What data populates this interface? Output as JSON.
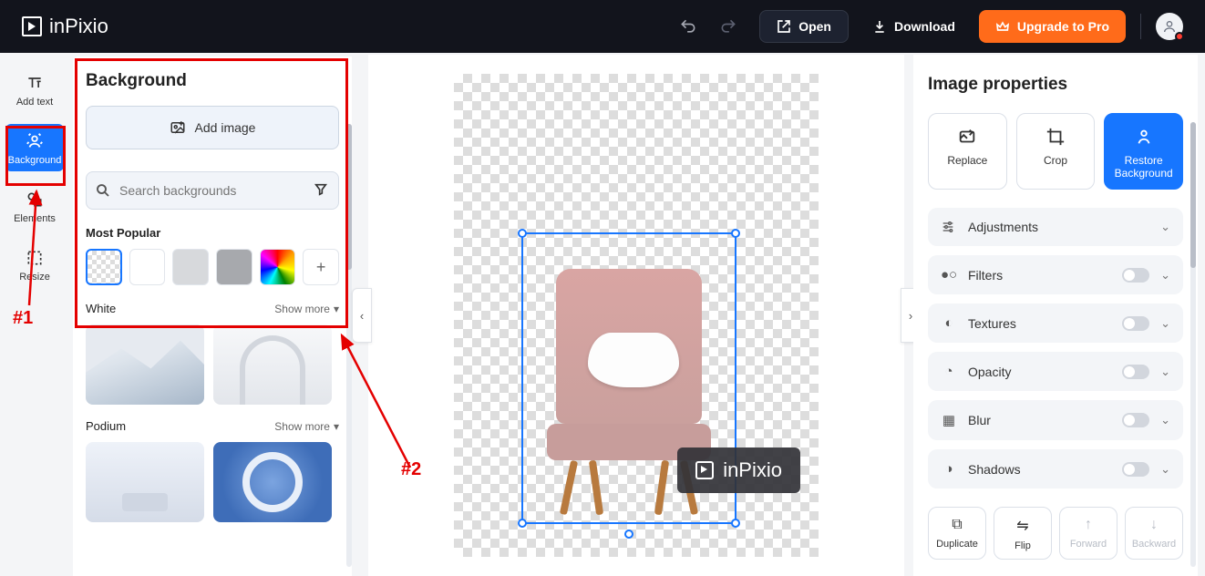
{
  "app_name": "inPixio",
  "header": {
    "undo_label": "Undo",
    "redo_label": "Redo",
    "open_label": "Open",
    "download_label": "Download",
    "upgrade_label": "Upgrade to Pro"
  },
  "rail": {
    "add_text": "Add text",
    "background": "Background",
    "elements": "Elements",
    "resize": "Resize"
  },
  "side": {
    "title": "Background",
    "add_image": "Add image",
    "search_placeholder": "Search backgrounds",
    "most_popular": "Most Popular",
    "plus": "+",
    "cat_white": "White",
    "cat_podium": "Podium",
    "show_more": "Show more"
  },
  "canvas": {
    "watermark": "inPixio"
  },
  "right": {
    "title": "Image properties",
    "replace": "Replace",
    "crop": "Crop",
    "restore": "Restore Background",
    "adjustments": "Adjustments",
    "filters": "Filters",
    "textures": "Textures",
    "opacity": "Opacity",
    "blur": "Blur",
    "shadows": "Shadows",
    "duplicate": "Duplicate",
    "flip": "Flip",
    "forward": "Forward",
    "backward": "Backward"
  },
  "annotations": {
    "one": "#1",
    "two": "#2"
  }
}
